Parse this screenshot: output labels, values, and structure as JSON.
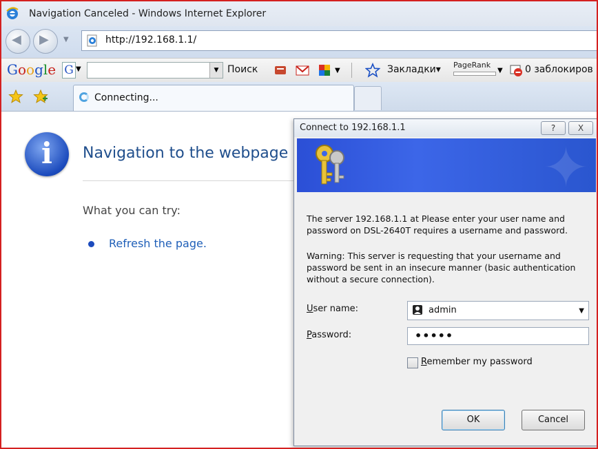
{
  "window": {
    "title": "Navigation Canceled - Windows Internet Explorer"
  },
  "address": {
    "url": "http://192.168.1.1/"
  },
  "google_toolbar": {
    "logo": "Google",
    "g_button": "G",
    "search_label": "Поиск",
    "bookmarks_label": "Закладки",
    "pagerank_label": "PageRank",
    "blocked_label": "0 заблокиров"
  },
  "tab": {
    "label": "Connecting..."
  },
  "page": {
    "title": "Navigation to the webpage was canceled",
    "try_heading": "What you can try:",
    "refresh_link": "Refresh the page."
  },
  "dialog": {
    "title": "Connect to 192.168.1.1",
    "help": "?",
    "close": "X",
    "message": "The server 192.168.1.1 at Please enter your user name and password on DSL-2640T requires a username and password.",
    "warning": "Warning: This server is requesting that your username and password be sent in an insecure manner (basic authentication without a secure connection).",
    "username_label": "User name:",
    "username_value": "admin",
    "password_label": "Password:",
    "password_value": "•••••",
    "remember_label": "Remember my password",
    "ok": "OK",
    "cancel": "Cancel"
  },
  "colors": {
    "frame_border": "#d42020",
    "link": "#1f5fb8",
    "banner": "#2b4fd6"
  }
}
